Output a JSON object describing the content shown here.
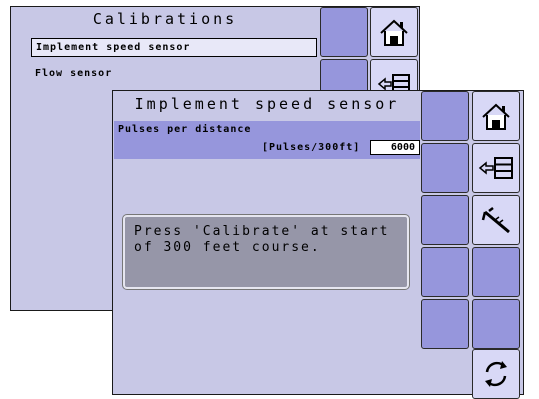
{
  "back_screen": {
    "title": "Calibrations",
    "items": [
      {
        "label": "Implement speed sensor",
        "selected": true
      },
      {
        "label": "Flow sensor",
        "selected": false
      }
    ]
  },
  "front_screen": {
    "title": "Implement speed sensor",
    "field_label": "Pulses per distance",
    "unit_label": "[Pulses/300ft]",
    "value": "6000",
    "message": "Press 'Calibrate' at start\nof 300 feet course."
  },
  "side_buttons": [
    {
      "icon": "home-icon"
    },
    {
      "icon": "back-list-icon"
    },
    {
      "icon": "caliper-icon"
    },
    {
      "icon": "refresh-icon"
    }
  ]
}
